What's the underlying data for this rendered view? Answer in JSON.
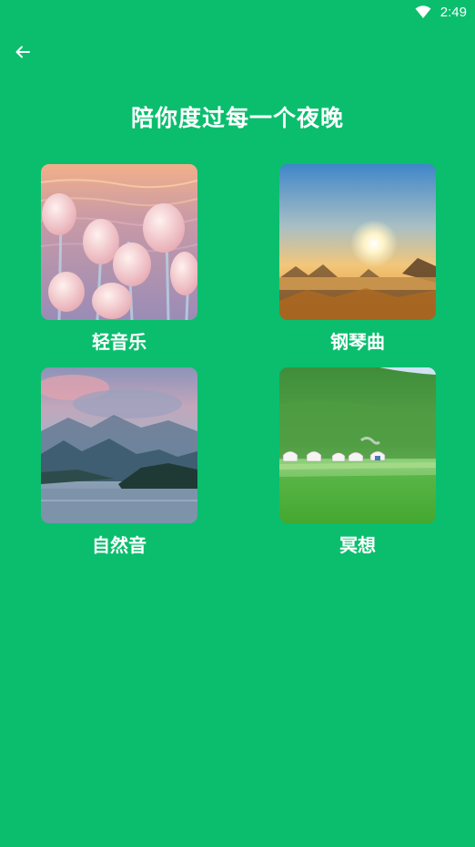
{
  "status_bar": {
    "time": "2:49"
  },
  "header": {
    "title": "陪你度过每一个夜晚"
  },
  "categories": [
    {
      "label": "轻音乐"
    },
    {
      "label": "钢琴曲"
    },
    {
      "label": "自然音"
    },
    {
      "label": "冥想"
    }
  ],
  "colors": {
    "background": "#0ABE6E",
    "text": "#FFFFFF"
  }
}
